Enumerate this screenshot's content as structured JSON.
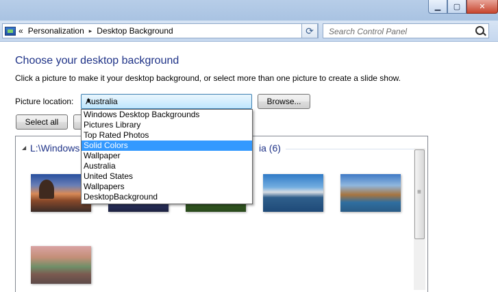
{
  "window": {
    "caption_buttons": [
      "minimize-icon",
      "maximize-icon",
      "close-icon"
    ]
  },
  "address_bar": {
    "nav_back": "«",
    "breadcrumbs": [
      "Personalization",
      "Desktop Background"
    ],
    "separator": "▸",
    "dropdown_glyph": "▾",
    "refresh_glyph": "⟳"
  },
  "search": {
    "placeholder": "Search Control Panel"
  },
  "page": {
    "heading": "Choose your desktop background",
    "description": "Click a picture to make it your desktop background, or select more than one picture to create a slide show."
  },
  "picture_location": {
    "label": "Picture location:",
    "selected": "Australia",
    "browse_label": "Browse...",
    "options": [
      "Windows Desktop Backgrounds",
      "Pictures Library",
      "Top Rated Photos",
      "Solid Colors",
      "Wallpaper",
      "Australia",
      "United States",
      "Wallpapers",
      "DesktopBackground"
    ],
    "highlighted": "Solid Colors"
  },
  "actions": {
    "select_all": "Select all"
  },
  "gallery": {
    "group_title_start": "L:\\Windows",
    "group_title_end": "ia (6)",
    "thumbnails": [
      "beach-sunset",
      "night-city",
      "green-forest",
      "sydney-harbour",
      "twelve-apostles",
      "red-rocks-river"
    ]
  },
  "colors": {
    "heading": "#1e3287",
    "highlight": "#3399ff"
  }
}
